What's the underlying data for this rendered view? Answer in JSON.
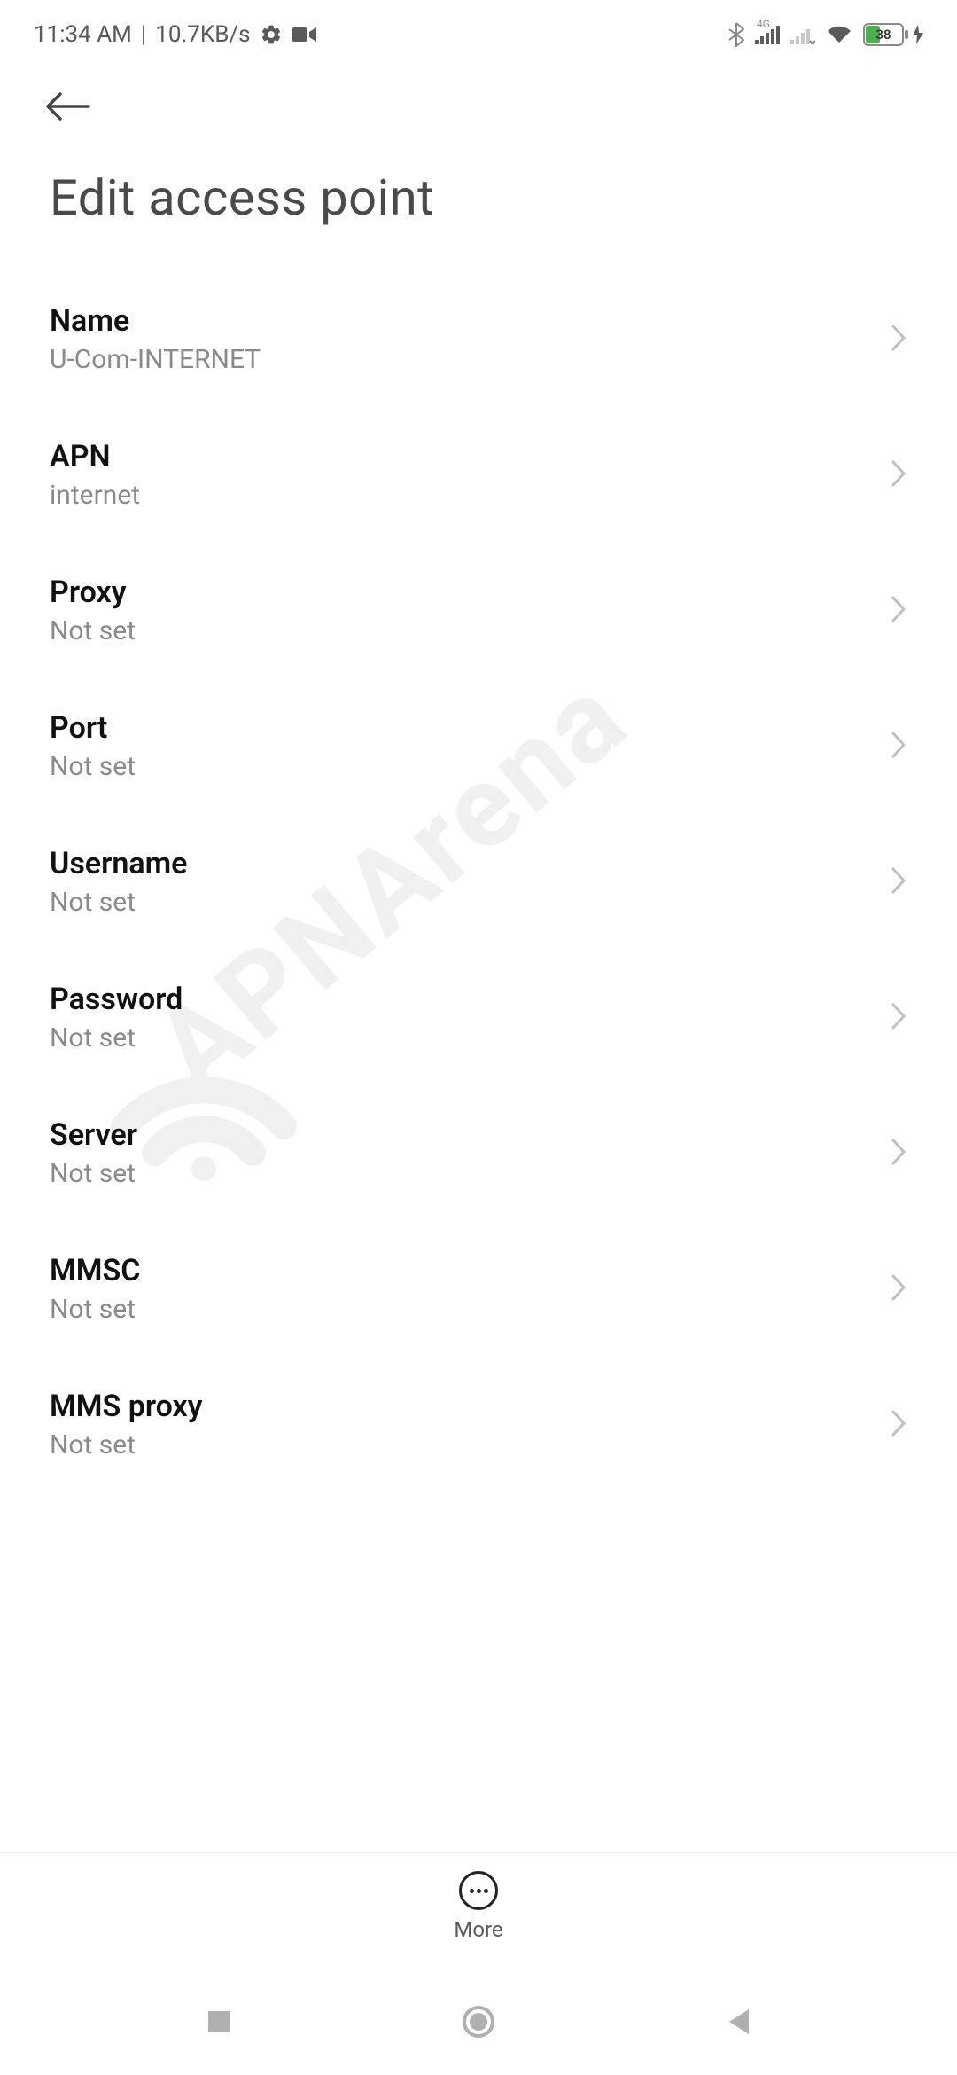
{
  "status": {
    "time": "11:34 AM",
    "net_speed": "10.7KB/s",
    "battery_pct": "38"
  },
  "header": {
    "title": "Edit access point"
  },
  "items": [
    {
      "label": "Name",
      "value": "U-Com-INTERNET"
    },
    {
      "label": "APN",
      "value": "internet"
    },
    {
      "label": "Proxy",
      "value": "Not set"
    },
    {
      "label": "Port",
      "value": "Not set"
    },
    {
      "label": "Username",
      "value": "Not set"
    },
    {
      "label": "Password",
      "value": "Not set"
    },
    {
      "label": "Server",
      "value": "Not set"
    },
    {
      "label": "MMSC",
      "value": "Not set"
    },
    {
      "label": "MMS proxy",
      "value": "Not set"
    }
  ],
  "bottom": {
    "more_label": "More"
  },
  "watermark": {
    "text": "APNArena"
  }
}
